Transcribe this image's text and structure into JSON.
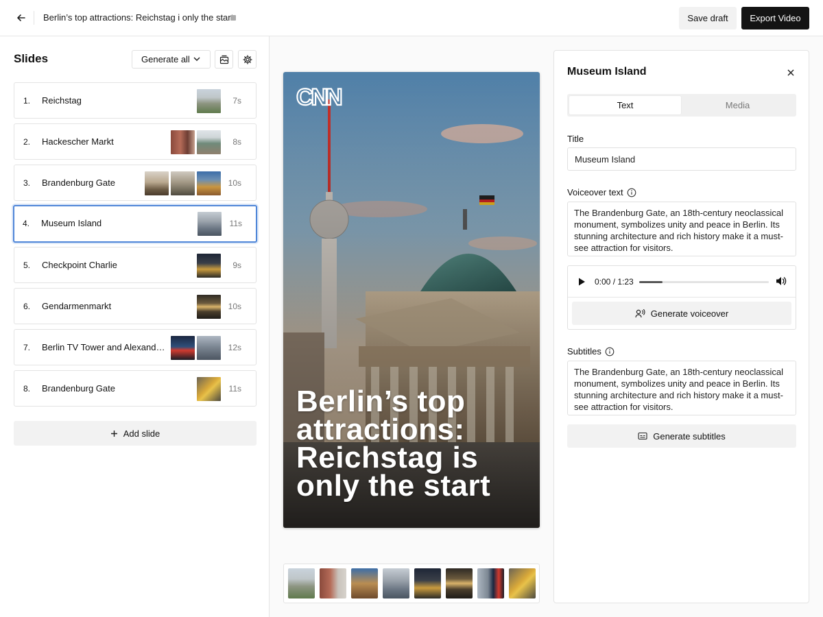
{
  "header": {
    "title": "Berlin’s top attractions: Reichstag i only the start",
    "save_label": "Save draft",
    "export_label": "Export Video"
  },
  "sidebar": {
    "title": "Slides",
    "generate_all_label": "Generate all",
    "add_slide_label": "Add slide",
    "slides": [
      {
        "num": "1.",
        "name": "Reichstag",
        "duration": "7s",
        "thumbs": 1
      },
      {
        "num": "2.",
        "name": "Hackescher Markt",
        "duration": "8s",
        "thumbs": 2
      },
      {
        "num": "3.",
        "name": "Brandenburg Gate",
        "duration": "10s",
        "thumbs": 3
      },
      {
        "num": "4.",
        "name": "Museum Island",
        "duration": "11s",
        "thumbs": 1,
        "selected": true
      },
      {
        "num": "5.",
        "name": "Checkpoint Charlie",
        "duration": "9s",
        "thumbs": 1
      },
      {
        "num": "6.",
        "name": "Gendarmenmarkt",
        "duration": "10s",
        "thumbs": 1
      },
      {
        "num": "7.",
        "name": "Berlin TV Tower and Alexanderplatz",
        "duration": "12s",
        "thumbs": 2
      },
      {
        "num": "8.",
        "name": "Brandenburg Gate",
        "duration": "11s",
        "thumbs": 1
      }
    ]
  },
  "preview": {
    "logo_text": "CNN",
    "overlay_title": "Berlin’s top attractions: Reichstag is only the start"
  },
  "panel": {
    "title": "Museum Island",
    "tabs": [
      {
        "label": "Text",
        "active": true
      },
      {
        "label": "Media",
        "active": false
      }
    ],
    "title_label": "Title",
    "title_value": "Museum Island",
    "voiceover_label": "Voiceover text",
    "voiceover_text": "The Brandenburg Gate, an 18th-century neoclassical monument, symbolizes unity and peace in Berlin. Its stunning architecture and rich history make it a must-see attraction for visitors.",
    "audio_time": "0:00 / 1:23",
    "audio_progress": 0.18,
    "generate_voiceover_label": "Generate voiceover",
    "subtitles_label": "Subtitles",
    "subtitles_text": "The Brandenburg Gate, an 18th-century neoclassical monument, symbolizes unity and peace in Berlin. Its stunning architecture and rich history make it a must-see attraction for visitors.",
    "generate_subtitles_label": "Generate subtitles"
  },
  "colors": {
    "accent": "#4f86d8",
    "export_button": "#141414"
  }
}
